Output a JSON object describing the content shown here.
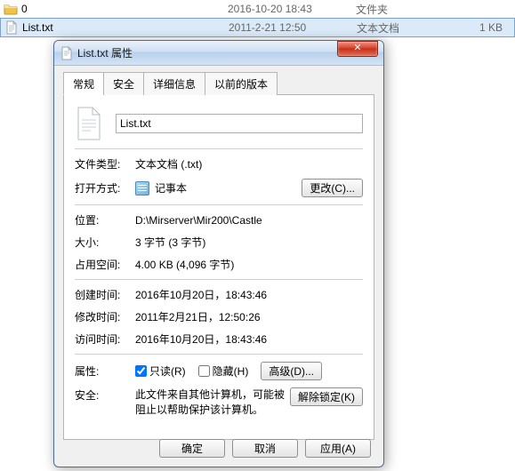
{
  "filelist": {
    "rows": [
      {
        "icon": "folder",
        "name": "0",
        "date": "2016-10-20 18:43",
        "type": "文件夹",
        "size": ""
      },
      {
        "icon": "txt",
        "name": "List.txt",
        "date": "2011-2-21 12:50",
        "type": "文本文档",
        "size": "1 KB"
      }
    ]
  },
  "dialog": {
    "title": "List.txt 属性",
    "close": "✕",
    "tabs": {
      "general": "常规",
      "security": "安全",
      "details": "详细信息",
      "previous": "以前的版本"
    },
    "filename": "List.txt",
    "labels": {
      "filetype": "文件类型:",
      "opens": "打开方式:",
      "location": "位置:",
      "size": "大小:",
      "ondisk": "占用空间:",
      "created": "创建时间:",
      "modified": "修改时间:",
      "accessed": "访问时间:",
      "attributes": "属性:",
      "securityLabel": "安全:"
    },
    "values": {
      "filetype": "文本文档 (.txt)",
      "opens": "记事本",
      "location": "D:\\Mirserver\\Mir200\\Castle",
      "size": "3 字节 (3 字节)",
      "ondisk": "4.00 KB (4,096 字节)",
      "created": "2016年10月20日，18:43:46",
      "modified": "2011年2月21日，12:50:26",
      "accessed": "2016年10月20日，18:43:46",
      "readonly": "只读(R)",
      "hidden": "隐藏(H)",
      "security": "此文件来自其他计算机，可能被阻止以帮助保护该计算机。"
    },
    "buttons": {
      "change": "更改(C)...",
      "advanced": "高级(D)...",
      "unblock": "解除锁定(K)",
      "ok": "确定",
      "cancel": "取消",
      "apply": "应用(A)"
    },
    "readonly_checked": true,
    "hidden_checked": false
  }
}
